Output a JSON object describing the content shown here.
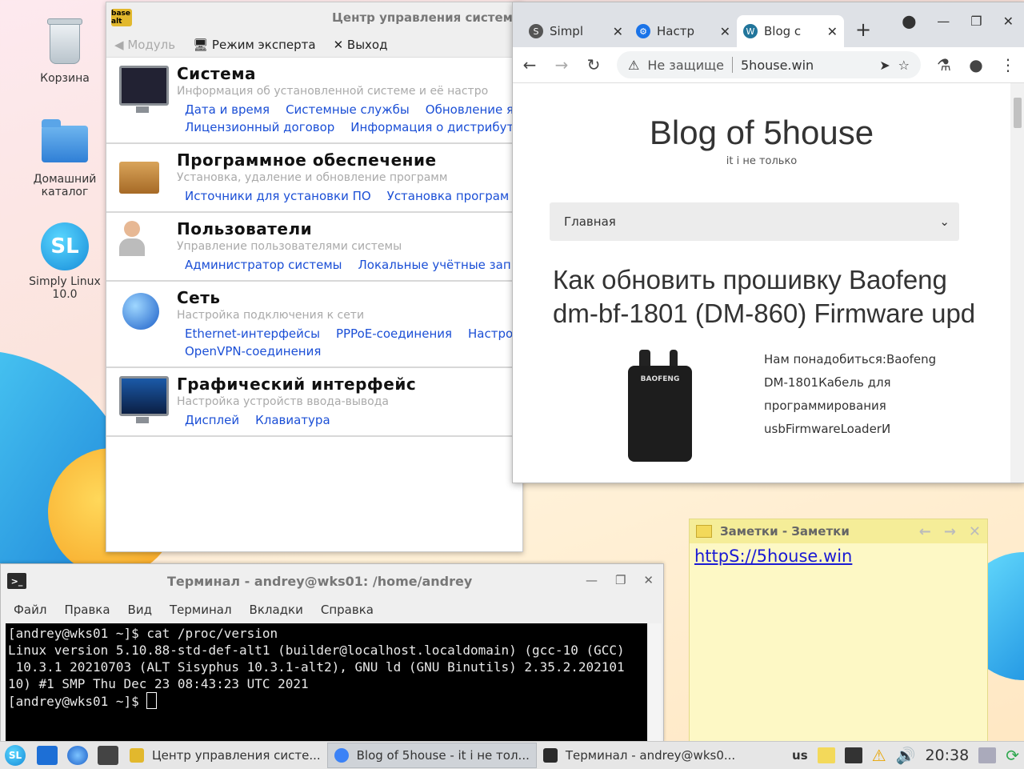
{
  "desktop": {
    "icons": [
      {
        "label": "Корзина"
      },
      {
        "label": "Домашний каталог"
      },
      {
        "label": "Simply Linux 10.0"
      }
    ],
    "sl_badge": "SL"
  },
  "control_center": {
    "app_badge": "base alt",
    "title": "Центр управления системо",
    "toolbar": {
      "module": "Модуль",
      "expert": "Режим эксперта",
      "exit": "Выход"
    },
    "sections": [
      {
        "title": "Система",
        "desc": "Информация об установленной системе и её настро",
        "links": [
          "Дата и время",
          "Системные службы",
          "Обновление я",
          "Лицензионный договор",
          "Информация о дистрибут"
        ]
      },
      {
        "title": "Программное обеспечение",
        "desc": "Установка, удаление и обновление программ",
        "links": [
          "Источники для установки ПО",
          "Установка програм"
        ]
      },
      {
        "title": "Пользователи",
        "desc": "Управление пользователями системы",
        "links": [
          "Администратор системы",
          "Локальные учётные зап"
        ]
      },
      {
        "title": "Сеть",
        "desc": "Настройка подключения к сети",
        "links": [
          "Ethernet-интерфейсы",
          "PPPoE-соединения",
          "Настро",
          "OpenVPN-соединения"
        ]
      },
      {
        "title": "Графический интерфейс",
        "desc": "Настройка устройств ввода-вывода",
        "links": [
          "Дисплей",
          "Клавиатура"
        ]
      }
    ]
  },
  "browser": {
    "tabs": [
      {
        "label": "Simpl",
        "icon": "S"
      },
      {
        "label": "Настр",
        "icon": "⚙"
      },
      {
        "label": "Blog c",
        "icon": "W"
      }
    ],
    "new_tab": "+",
    "address": {
      "security": "Не защище",
      "url": "5house.win"
    },
    "page": {
      "site_title": "Blog of 5house",
      "site_subtitle": "it і не только",
      "nav_selected": "Главная",
      "post_title": "Как обновить прошивку Baofeng dm-bf-1801 (DM-860) Firmware upd",
      "radio_brand": "BAOFENG",
      "post_lines": [
        "Нам понадобиться:Baofeng",
        "DM-1801Кабель для",
        "программирования",
        "usbFirmwareLoaderИ"
      ]
    }
  },
  "notes": {
    "title": "Заметки - Заметки",
    "text": "httpS://5house.win"
  },
  "terminal": {
    "icon_text": ">_",
    "title": "Терминал - andrey@wks01: /home/andrey",
    "menu": [
      "Файл",
      "Правка",
      "Вид",
      "Терминал",
      "Вкладки",
      "Справка"
    ],
    "lines": [
      "[andrey@wks01 ~]$ cat /proc/version",
      "Linux version 5.10.88-std-def-alt1 (builder@localhost.localdomain) (gcc-10 (GCC)",
      " 10.3.1 20210703 (ALT Sisyphus 10.3.1-alt2), GNU ld (GNU Binutils) 2.35.2.202101",
      "10) #1 SMP Thu Dec 23 08:43:23 UTC 2021",
      "[andrey@wks01 ~]$ "
    ]
  },
  "taskbar": {
    "start_badge": "SL",
    "tasks": [
      {
        "label": "Центр управления систе..."
      },
      {
        "label": "Blog of 5house - it і не тол..."
      },
      {
        "label": "Терминал - andrey@wks0..."
      }
    ],
    "lang": "us",
    "clock": "20:38"
  }
}
